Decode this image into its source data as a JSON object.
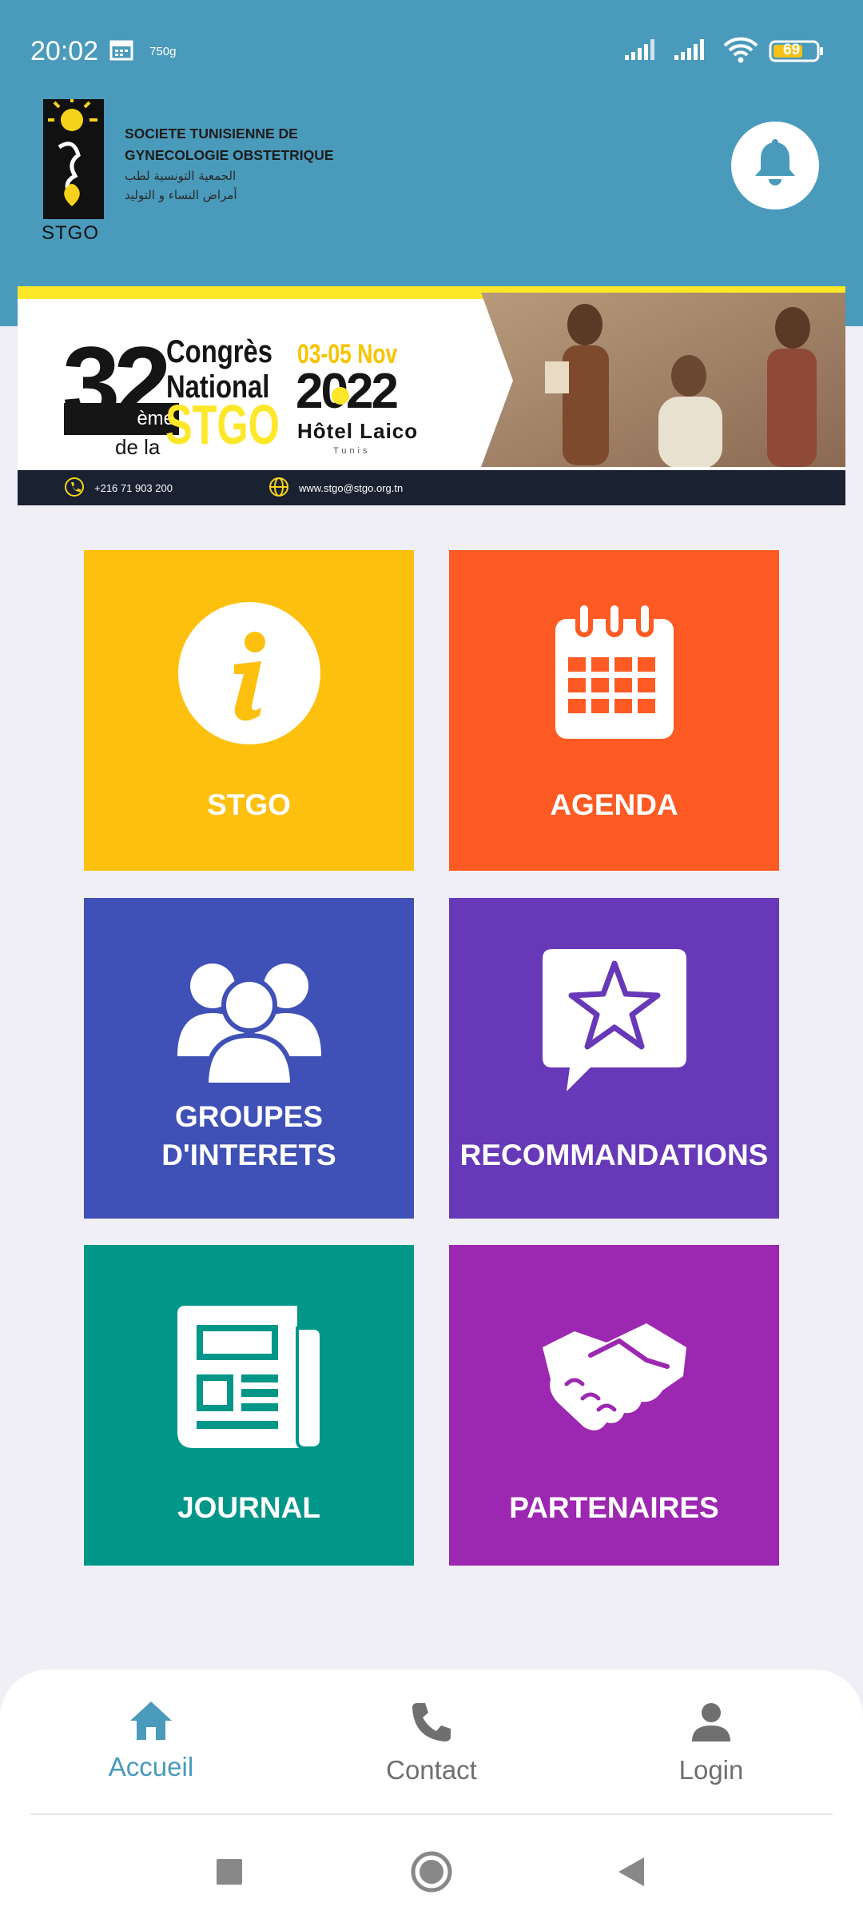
{
  "status_bar": {
    "time": "20:02",
    "extra": "750g",
    "battery": "69"
  },
  "header": {
    "logo_caption": "STGO",
    "org_name_fr_line1": "SOCIETE TUNISIENNE DE",
    "org_name_fr_line2": "GYNECOLOGIE OBSTETRIQUE",
    "org_name_ar_line1": "الجمعية التونسية لطب",
    "org_name_ar_line2": "أمراض النساء و التوليد"
  },
  "banner": {
    "edition_number": "32",
    "edition_suffix": "ème",
    "title_line1": "Congrès",
    "title_line2": "National",
    "of_the": "de la",
    "org": "STGO",
    "dates": "03-05 Nov",
    "year": "2022",
    "venue": "Hôtel Laico",
    "city": "Tunis",
    "phone": "+216 71 903 200",
    "website": "www.stgo@stgo.org.tn"
  },
  "tiles": [
    {
      "label": "STGO",
      "color": "#fdc00f",
      "icon": "info-icon"
    },
    {
      "label": "AGENDA",
      "color": "#fe5a23",
      "icon": "calendar-icon"
    },
    {
      "label_line1": "GROUPES",
      "label_line2": "D'INTERETS",
      "color": "#3f50b6",
      "icon": "users-group-icon"
    },
    {
      "label": "RECOMMANDATIONS",
      "color": "#6738b8",
      "icon": "star-speech-bubble-icon"
    },
    {
      "label": "JOURNAL",
      "color": "#009688",
      "icon": "newspaper-icon"
    },
    {
      "label": "PARTENAIRES",
      "color": "#9c27b0",
      "icon": "handshake-icon"
    }
  ],
  "bottom_nav": {
    "items": [
      {
        "label": "Accueil",
        "icon": "home-icon",
        "active": true
      },
      {
        "label": "Contact",
        "icon": "phone-icon",
        "active": false
      },
      {
        "label": "Login",
        "icon": "person-icon",
        "active": false
      }
    ],
    "active_color": "#4a9abb",
    "inactive_color": "#6f6f6f"
  },
  "colors": {
    "header": "#4a9abb",
    "background": "#f0eff6"
  }
}
